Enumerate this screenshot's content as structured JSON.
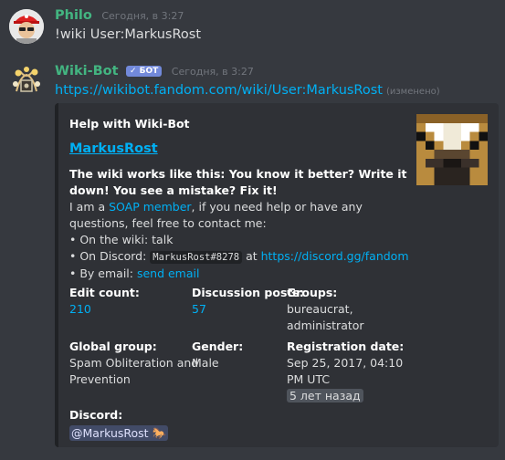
{
  "messages": [
    {
      "author": "Philo",
      "timestamp": "Сегодня, в 3:27",
      "text": "!wiki User:MarkusRost"
    },
    {
      "author": "Wiki-Bot",
      "badge": "✓ БОТ",
      "timestamp": "Сегодня, в 3:27",
      "link": "https://wikibot.fandom.com/wiki/User:MarkusRost",
      "edited": "(изменено)"
    }
  ],
  "embed": {
    "author": "Help with Wiki-Bot",
    "title": "MarkusRost",
    "desc_bold": "The wiki works like this: You know it better? Write it down! You see a mistake? Fix it!",
    "desc_iam": "I am a ",
    "desc_soap": "SOAP member",
    "desc_rest": ", if you need help or have any questions, feel free to contact me:",
    "bullet1": "• On the wiki: talk",
    "bullet2_prefix": "• On Discord: ",
    "bullet2_code": "MarkusRost#8278",
    "bullet2_at": " at ",
    "bullet2_link": "https://discord.gg/fandom",
    "bullet3_prefix": "• By email: ",
    "bullet3_link": "send email",
    "fields": {
      "edit_count": {
        "name": "Edit count:",
        "value": "210"
      },
      "discussion_posts": {
        "name": "Discussion posts:",
        "value": "57"
      },
      "groups": {
        "name": "Groups:",
        "value1": "bureaucrat,",
        "value2": "administrator"
      },
      "global_group": {
        "name": "Global group:",
        "value1": "Spam Obliteration and",
        "value2": "Prevention"
      },
      "gender": {
        "name": "Gender:",
        "value": "Male"
      },
      "registration": {
        "name": "Registration date:",
        "value1": "Sep 25, 2017, 04:10",
        "value2": "PM UTC",
        "relative": "5 лет назад"
      },
      "discord": {
        "name": "Discord:",
        "mention": "@MarkusRost",
        "emoji": "🐎"
      }
    }
  },
  "colors": {
    "background": "#36393f",
    "embed_bg": "#2f3136",
    "link": "#00b0f4",
    "username": "#43b581",
    "bot_badge": "#7289da"
  }
}
